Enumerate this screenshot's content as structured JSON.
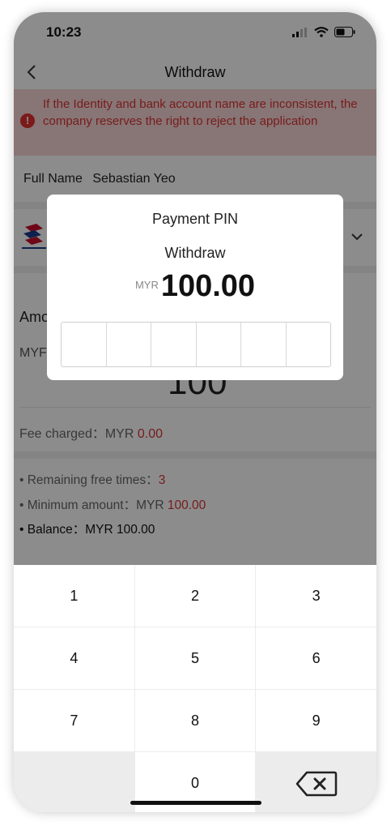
{
  "status_bar": {
    "time": "10:23"
  },
  "nav": {
    "title": "Withdraw"
  },
  "warning": {
    "text": "If the Identity and bank account name are inconsistent, the company reserves the right to reject the application"
  },
  "profile": {
    "name_label": "Full Name",
    "name_value": "Sebastian Yeo"
  },
  "amount": {
    "label": "Amo",
    "currency": "MYF",
    "digits": "100"
  },
  "fee": {
    "label": "Fee charged：MYR",
    "value": "0.00"
  },
  "info": {
    "remaining_label": "• Remaining free times：",
    "remaining_value": "3",
    "minimum_label": "• Minimum amount：MYR",
    "minimum_value": "100.00",
    "balance": "• Balance：MYR 100.00"
  },
  "modal": {
    "title": "Payment PIN",
    "subtitle": "Withdraw",
    "currency": "MYR",
    "amount": "100.00"
  },
  "keypad": {
    "keys": [
      "1",
      "2",
      "3",
      "4",
      "5",
      "6",
      "7",
      "8",
      "9",
      "",
      "0",
      ""
    ]
  },
  "colors": {
    "accent_red": "#d93333",
    "warning_bg": "#f7d6d6"
  }
}
